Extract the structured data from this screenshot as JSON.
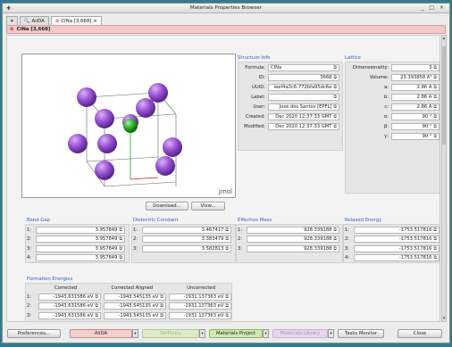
{
  "window": {
    "title": "Materials Properties Browser",
    "controls": "_ □ ×"
  },
  "tabs": [
    {
      "label": "AiiDA"
    },
    {
      "label": "ClNa [3,668]",
      "close": "×"
    }
  ],
  "page_header": "ClNa [3,668]",
  "viewer": {
    "watermark": "Jmol"
  },
  "viewer_buttons": {
    "download": "Download...",
    "view": "View..."
  },
  "structure_info": {
    "title": "Structure Info",
    "rows": [
      {
        "label": "Formula:",
        "value": "ClNa",
        "align": "left"
      },
      {
        "label": "ID:",
        "value": "3668"
      },
      {
        "label": "UUID:",
        "value": "ieef4a3c6-772bfa95dc6e"
      },
      {
        "label": "Label:",
        "value": ""
      },
      {
        "label": "User:",
        "value": "José dos Santos [EPFL]"
      },
      {
        "label": "Created:",
        "value": "Dec 2020 12:37:33 GMT"
      },
      {
        "label": "Modified:",
        "value": "Dec 2020 12:37:33 GMT"
      }
    ]
  },
  "lattice": {
    "title": "Lattice",
    "rows": [
      {
        "label": "Dimensionality:",
        "value": "3"
      },
      {
        "label": "Volume:",
        "value": "23.393858 Å³"
      },
      {
        "label": "a:",
        "value": "2.86 Å"
      },
      {
        "label": "b:",
        "value": "2.86 Å"
      },
      {
        "label": "c:",
        "value": "2.86 Å"
      },
      {
        "label": "α:",
        "value": "90 °"
      },
      {
        "label": "β:",
        "value": "90 °"
      },
      {
        "label": "γ:",
        "value": "90 °"
      }
    ]
  },
  "band_gap": {
    "title": "Band Gap",
    "rows": [
      {
        "idx": "1:",
        "value": "3.957849"
      },
      {
        "idx": "2:",
        "value": "3.957849"
      },
      {
        "idx": "3:",
        "value": "3.957849"
      },
      {
        "idx": "4:",
        "value": "3.957849"
      }
    ]
  },
  "dielectric": {
    "title": "Dielectric Constant",
    "rows": [
      {
        "idx": "1:",
        "value": "3.467417"
      },
      {
        "idx": "2:",
        "value": "3.383479"
      },
      {
        "idx": "3:",
        "value": "3.582813"
      }
    ]
  },
  "effective_mass": {
    "title": "Effective Mass",
    "rows": [
      {
        "idx": "1:",
        "value": "928.339188"
      },
      {
        "idx": "2:",
        "value": "928.339188"
      },
      {
        "idx": "3:",
        "value": "928.339188"
      }
    ]
  },
  "relaxed_energy": {
    "title": "Relaxed Energy",
    "rows": [
      {
        "idx": "1:",
        "value": "-1753.517816"
      },
      {
        "idx": "2:",
        "value": "-1753.517816"
      },
      {
        "idx": "3:",
        "value": "-1753.517816"
      },
      {
        "idx": "4:",
        "value": "-1753.517816"
      }
    ]
  },
  "formation": {
    "title": "Formation Energies",
    "headers": [
      "Corrected",
      "Corrected Aligned",
      "Uncorrected"
    ],
    "rows": [
      {
        "idx": "1:",
        "c": "-1943.631586 eV",
        "ca": "-1943.545135 eV",
        "u": "-1931.137363 eV"
      },
      {
        "idx": "2:",
        "c": "-1943.631586 eV",
        "ca": "-1943.545135 eV",
        "u": "-1931.137363 eV"
      },
      {
        "idx": "3:",
        "c": "-1943.631586 eV",
        "ca": "-1943.545135 eV",
        "u": "-1931.137363 eV"
      }
    ]
  },
  "statusbar": {
    "preferences": "Preferences...",
    "aiida": "AiiDA",
    "siripietry": "SiriPietry",
    "materials_project": "Materials Project",
    "materials_library": "Materials Library",
    "tasks_monitor": "Tasks Monitor",
    "close": "Close"
  },
  "colors": {
    "accent_blue": "#2e62b8",
    "header_pink": "#f2c8c8",
    "atom_purple": "#9a52d6",
    "atom_green": "#2bb32b"
  }
}
